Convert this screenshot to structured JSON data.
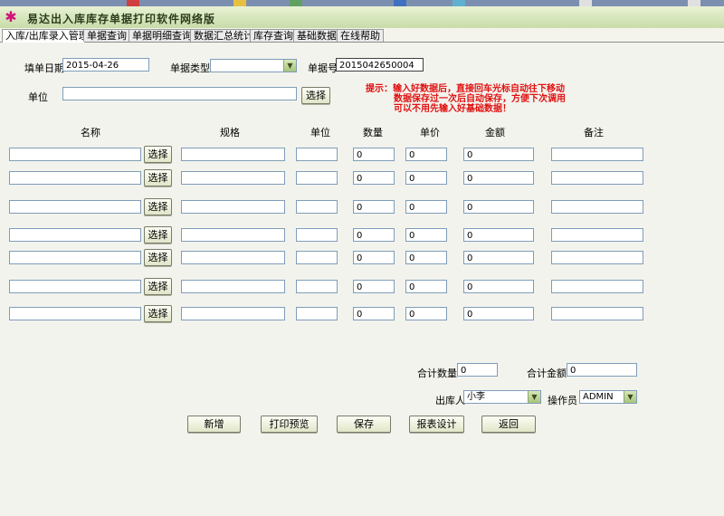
{
  "title": "易达出入库库存单据打印软件网络版",
  "tabs": [
    "入库/出库录入管理",
    "单据查询",
    "单据明细查询",
    "数据汇总统计",
    "库存查询",
    "基础数据",
    "在线帮助"
  ],
  "form": {
    "date_label": "填单日期",
    "date_value": "2015-04-26",
    "type_label": "单据类型",
    "type_value": "",
    "number_label": "单据号",
    "number_value": "2015042650004",
    "unit_label": "单位",
    "unit_value": "",
    "select_label": "选择"
  },
  "hint": {
    "line1": "提示：输入好数据后，直接回车光标自动往下移动",
    "line2": "数据保存过一次后自动保存，方便下次调用",
    "line3": "可以不用先输入好基础数据！"
  },
  "columns": {
    "name": "名称",
    "spec": "规格",
    "unit": "单位",
    "qty": "数量",
    "price": "单价",
    "amount": "金额",
    "note": "备注"
  },
  "rows": [
    {
      "name": "",
      "spec": "",
      "unit": "",
      "qty": "0",
      "price": "0",
      "amount": "0",
      "note": ""
    },
    {
      "name": "",
      "spec": "",
      "unit": "",
      "qty": "0",
      "price": "0",
      "amount": "0",
      "note": ""
    },
    {
      "name": "",
      "spec": "",
      "unit": "",
      "qty": "0",
      "price": "0",
      "amount": "0",
      "note": ""
    },
    {
      "name": "",
      "spec": "",
      "unit": "",
      "qty": "0",
      "price": "0",
      "amount": "0",
      "note": ""
    },
    {
      "name": "",
      "spec": "",
      "unit": "",
      "qty": "0",
      "price": "0",
      "amount": "0",
      "note": ""
    },
    {
      "name": "",
      "spec": "",
      "unit": "",
      "qty": "0",
      "price": "0",
      "amount": "0",
      "note": ""
    },
    {
      "name": "",
      "spec": "",
      "unit": "",
      "qty": "0",
      "price": "0",
      "amount": "0",
      "note": ""
    }
  ],
  "totals": {
    "qty_label": "合计数量",
    "qty_value": "0",
    "amount_label": "合计金额",
    "amount_value": "0"
  },
  "people": {
    "outbound_label": "出库人",
    "outbound_value": "小李",
    "operator_label": "操作员",
    "operator_value": "ADMIN"
  },
  "buttons": {
    "new": "新增",
    "print_preview": "打印预览",
    "save": "保存",
    "report_design": "报表设计",
    "back": "返回"
  }
}
